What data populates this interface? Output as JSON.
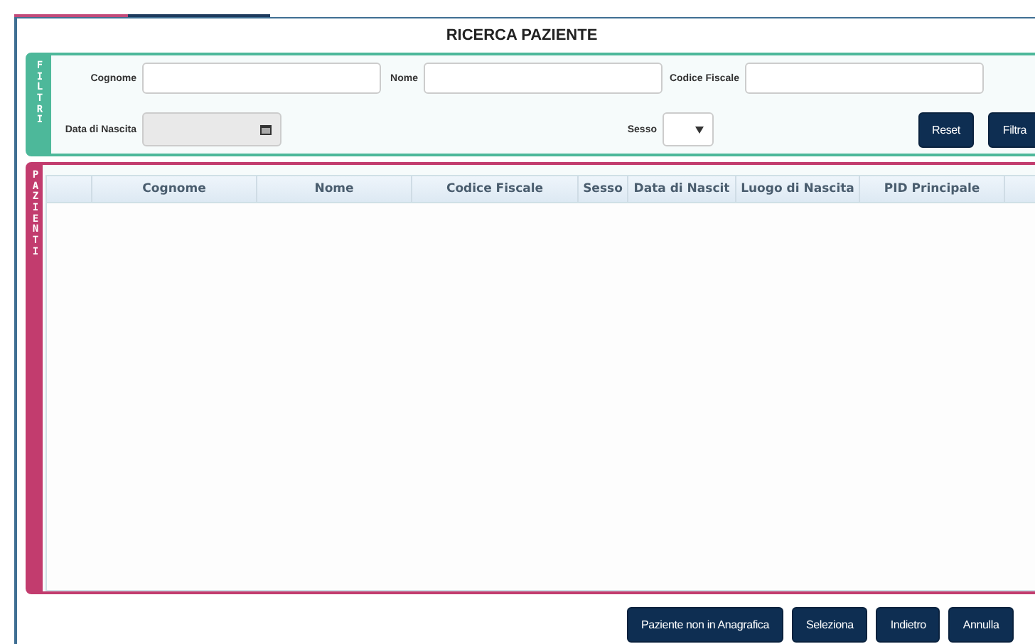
{
  "window": {
    "title": "RICERCA PAZIENTE"
  },
  "filters": {
    "side_label": "FILTRI",
    "fields": [
      {
        "kind": "text",
        "label": "Cognome"
      },
      {
        "kind": "text",
        "label": "Nome"
      },
      {
        "kind": "text",
        "label": "Codice Fiscale"
      },
      {
        "kind": "date",
        "label": "Data di Nascita",
        "disabled": true
      },
      {
        "kind": "select",
        "label": "Sesso"
      }
    ],
    "buttons": [
      "Reset",
      "Filtra"
    ]
  },
  "patients": {
    "side_label": "PAZIENTI",
    "table": {
      "columns": [
        "",
        "Cognome",
        "Nome",
        "Codice Fiscale",
        "Sesso",
        "Data di Nascit",
        "Luogo di Nascita",
        "PID Principale",
        ""
      ]
    }
  },
  "buttons": [
    "Paziente non in Anagrafica",
    "Seleziona",
    "Indietro",
    "Annulla"
  ]
}
